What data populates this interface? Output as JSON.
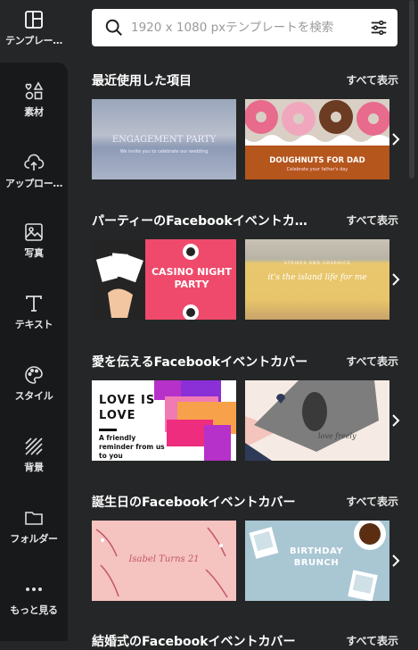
{
  "sidebar": {
    "items": [
      {
        "label": "テンプレー…",
        "icon": "templates-icon"
      },
      {
        "label": "素材",
        "icon": "elements-icon"
      },
      {
        "label": "アップロー…",
        "icon": "upload-icon"
      },
      {
        "label": "写真",
        "icon": "photo-icon"
      },
      {
        "label": "テキスト",
        "icon": "text-icon"
      },
      {
        "label": "スタイル",
        "icon": "palette-icon"
      },
      {
        "label": "背景",
        "icon": "background-icon"
      },
      {
        "label": "フォルダー",
        "icon": "folder-icon"
      },
      {
        "label": "もっと見る",
        "icon": "more-icon"
      }
    ]
  },
  "search": {
    "placeholder": "1920 x 1080 pxテンプレートを検索"
  },
  "sections": [
    {
      "title": "最近使用した項目",
      "see_all": "すべて表示",
      "thumbs": [
        {
          "text": "ENGAGEMENT PARTY",
          "sub": "We invite you to celebrate our wedding"
        },
        {
          "text": "DOUGHNUTS FOR DAD",
          "sub": "Celebrate your father's day"
        }
      ]
    },
    {
      "title": "パーティーのFacebookイベントカ…",
      "see_all": "すべて表示",
      "thumbs": [
        {
          "text": "CASINO NIGHT PARTY",
          "sub": ""
        },
        {
          "text": "it's the island life for me",
          "sub": "STRIKES AND GRAPHICS"
        }
      ]
    },
    {
      "title": "愛を伝えるFacebookイベントカバー",
      "see_all": "すべて表示",
      "thumbs": [
        {
          "text": "LOVE IS LOVE",
          "sub": "A friendly reminder from us to you"
        },
        {
          "text": "love freely",
          "sub": ""
        }
      ]
    },
    {
      "title": "誕生日のFacebookイベントカバー",
      "see_all": "すべて表示",
      "thumbs": [
        {
          "text": "Isabel Turns 21",
          "sub": ""
        },
        {
          "text": "BIRTHDAY BRUNCH",
          "sub": ""
        }
      ]
    },
    {
      "title": "結婚式のFacebookイベントカバー",
      "see_all": "すべて表示",
      "thumbs": []
    }
  ],
  "colors": {
    "sidebar": "#18191b",
    "panel": "#252627",
    "accent": "#ffffff"
  }
}
